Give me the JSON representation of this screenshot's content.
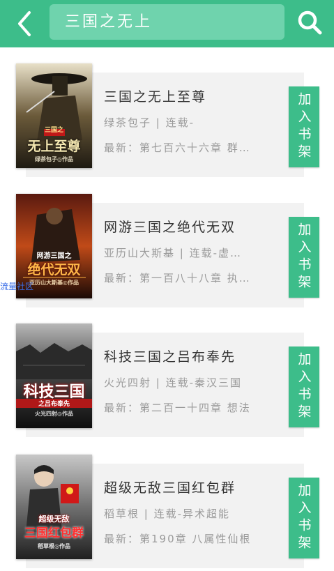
{
  "header": {
    "search_value": "三国之无上",
    "back_icon": "chevron-left-icon",
    "search_icon": "search-icon",
    "color": "#3dbd8a"
  },
  "books": [
    {
      "title": "三国之无上至尊",
      "author": "绿茶包子 | 连载-",
      "latest": "最新：第七百六十六章 群…",
      "button": "加入书架",
      "cover_title": "三国之",
      "cover_title2": "无上至尊",
      "cover_author": "绿茶包子◎作品"
    },
    {
      "title": "网游三国之绝代无双",
      "author": "亚历山大斯基 | 连载-虚…",
      "latest": "最新：第一百八十八章 执…",
      "button": "加入书架",
      "cover_title": "网游三国之",
      "cover_title2": "绝代无双",
      "cover_author": "亚历山大斯基◎作品"
    },
    {
      "title": "科技三国之吕布奉先",
      "author": "火光四射 | 连载-秦汉三国",
      "latest": "最新：第二百一十四章 想法",
      "button": "加入书架",
      "cover_title": "科技三国",
      "cover_title2": "之吕布奉先",
      "cover_author": "火光四射◎作品"
    },
    {
      "title": "超级无敌三国红包群",
      "author": "稻草根 | 连载-异术超能",
      "latest": "最新：第190章 八属性仙根",
      "button": "加入书架",
      "cover_title": "超级无敌",
      "cover_title2": "三国红包群",
      "cover_author": "稻草根◎作品"
    }
  ],
  "watermark": "流量社区"
}
